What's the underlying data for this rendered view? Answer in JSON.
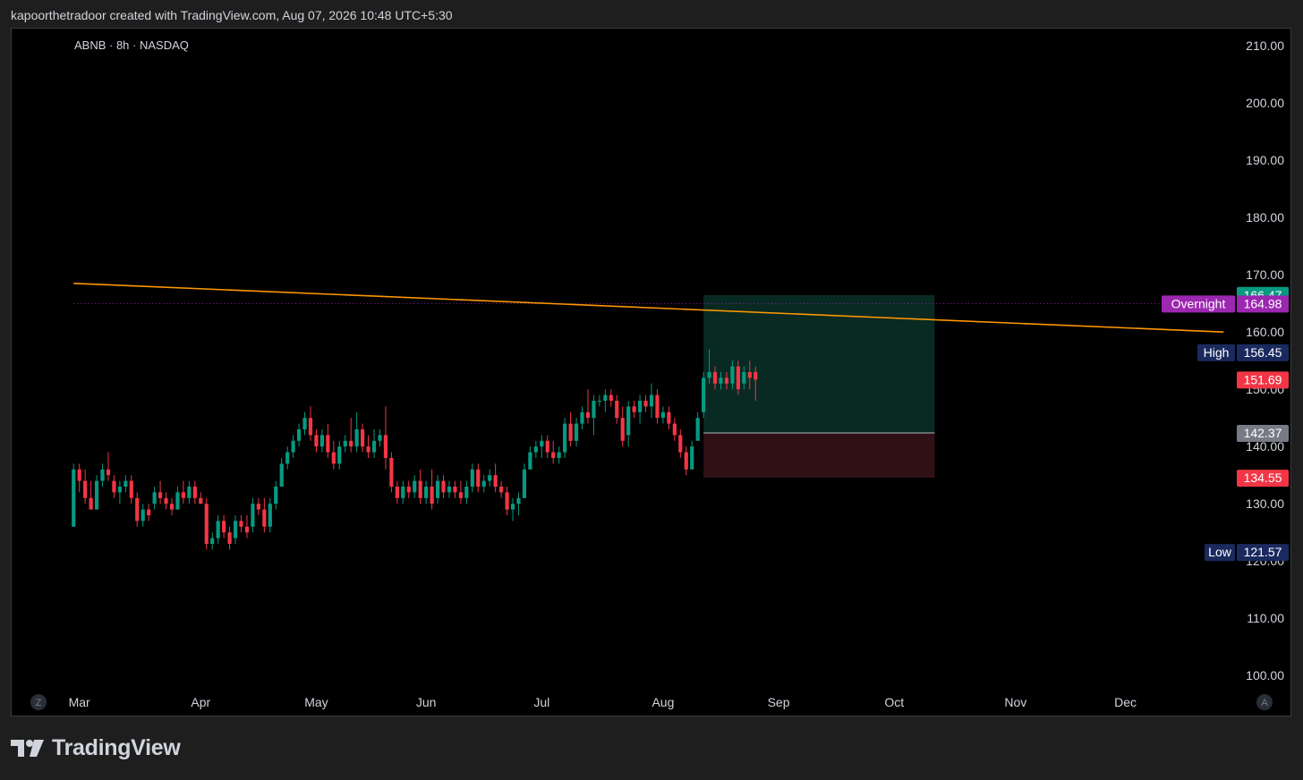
{
  "header": {
    "text": "kapoorthetradoor created with TradingView.com, Aug 07, 2026 10:48 UTC+5:30"
  },
  "footer": {
    "brand": "TradingView"
  },
  "chart_data": {
    "type": "candlestick",
    "title": "ABNB · 8h · NASDAQ",
    "symbol": "ABNB",
    "interval": "8h",
    "exchange": "NASDAQ",
    "ylim": [
      98,
      213
    ],
    "y_ticks": [
      "210.00",
      "200.00",
      "190.00",
      "180.00",
      "170.00",
      "160.00",
      "150.00",
      "140.00",
      "130.00",
      "120.00",
      "110.00",
      "100.00"
    ],
    "x_ticks": [
      {
        "label": "Mar",
        "index": 1
      },
      {
        "label": "Apr",
        "index": 22
      },
      {
        "label": "May",
        "index": 42
      },
      {
        "label": "Jun",
        "index": 61
      },
      {
        "label": "Jul",
        "index": 81
      },
      {
        "label": "Aug",
        "index": 102
      },
      {
        "label": "Sep",
        "index": 122
      },
      {
        "label": "Oct",
        "index": 142
      },
      {
        "label": "Nov",
        "index": 163
      },
      {
        "label": "Dec",
        "index": 182
      }
    ],
    "x_range": [
      -0.5,
      200.5
    ],
    "candles": [
      {
        "i": 0,
        "o": 126,
        "h": 137,
        "l": 126,
        "c": 136
      },
      {
        "i": 1,
        "o": 136,
        "h": 137,
        "l": 132,
        "c": 134
      },
      {
        "i": 2,
        "o": 134,
        "h": 136,
        "l": 130,
        "c": 131
      },
      {
        "i": 3,
        "o": 131,
        "h": 134,
        "l": 129,
        "c": 129
      },
      {
        "i": 4,
        "o": 129,
        "h": 135,
        "l": 129,
        "c": 134
      },
      {
        "i": 5,
        "o": 134,
        "h": 137,
        "l": 133,
        "c": 136
      },
      {
        "i": 6,
        "o": 136,
        "h": 139,
        "l": 134,
        "c": 135
      },
      {
        "i": 7,
        "o": 134,
        "h": 135,
        "l": 131,
        "c": 132
      },
      {
        "i": 8,
        "o": 132,
        "h": 134,
        "l": 130,
        "c": 133
      },
      {
        "i": 9,
        "o": 133,
        "h": 135,
        "l": 132,
        "c": 134
      },
      {
        "i": 10,
        "o": 134,
        "h": 135,
        "l": 130,
        "c": 131
      },
      {
        "i": 11,
        "o": 131,
        "h": 132,
        "l": 126,
        "c": 127
      },
      {
        "i": 12,
        "o": 127,
        "h": 130,
        "l": 126,
        "c": 129
      },
      {
        "i": 13,
        "o": 129,
        "h": 130,
        "l": 127,
        "c": 128
      },
      {
        "i": 14,
        "o": 130,
        "h": 133,
        "l": 129,
        "c": 132
      },
      {
        "i": 15,
        "o": 132,
        "h": 134,
        "l": 130,
        "c": 131
      },
      {
        "i": 16,
        "o": 131,
        "h": 132,
        "l": 129,
        "c": 130
      },
      {
        "i": 17,
        "o": 130,
        "h": 131,
        "l": 128,
        "c": 129
      },
      {
        "i": 18,
        "o": 129,
        "h": 133,
        "l": 129,
        "c": 132
      },
      {
        "i": 19,
        "o": 132,
        "h": 134,
        "l": 130,
        "c": 131
      },
      {
        "i": 20,
        "o": 131,
        "h": 134,
        "l": 130,
        "c": 133
      },
      {
        "i": 21,
        "o": 133,
        "h": 134,
        "l": 130,
        "c": 131
      },
      {
        "i": 22,
        "o": 131,
        "h": 132,
        "l": 130,
        "c": 130
      },
      {
        "i": 23,
        "o": 130,
        "h": 131,
        "l": 122,
        "c": 123
      },
      {
        "i": 24,
        "o": 123,
        "h": 125,
        "l": 122,
        "c": 124
      },
      {
        "i": 25,
        "o": 124,
        "h": 128,
        "l": 123,
        "c": 127
      },
      {
        "i": 26,
        "o": 127,
        "h": 128,
        "l": 124,
        "c": 125
      },
      {
        "i": 27,
        "o": 125,
        "h": 126,
        "l": 122,
        "c": 123
      },
      {
        "i": 28,
        "o": 124,
        "h": 128,
        "l": 123,
        "c": 127
      },
      {
        "i": 29,
        "o": 127,
        "h": 128,
        "l": 125,
        "c": 126
      },
      {
        "i": 30,
        "o": 126,
        "h": 128,
        "l": 124,
        "c": 125
      },
      {
        "i": 31,
        "o": 126,
        "h": 131,
        "l": 125,
        "c": 130
      },
      {
        "i": 32,
        "o": 130,
        "h": 131,
        "l": 128,
        "c": 129
      },
      {
        "i": 33,
        "o": 129,
        "h": 131,
        "l": 125,
        "c": 126
      },
      {
        "i": 34,
        "o": 126,
        "h": 131,
        "l": 125,
        "c": 130
      },
      {
        "i": 35,
        "o": 130,
        "h": 134,
        "l": 129,
        "c": 133
      },
      {
        "i": 36,
        "o": 133,
        "h": 138,
        "l": 133,
        "c": 137
      },
      {
        "i": 37,
        "o": 137,
        "h": 140,
        "l": 136,
        "c": 139
      },
      {
        "i": 38,
        "o": 139,
        "h": 142,
        "l": 138,
        "c": 141
      },
      {
        "i": 39,
        "o": 141,
        "h": 144,
        "l": 140,
        "c": 143
      },
      {
        "i": 40,
        "o": 143,
        "h": 146,
        "l": 142,
        "c": 145
      },
      {
        "i": 41,
        "o": 145,
        "h": 147,
        "l": 141,
        "c": 142
      },
      {
        "i": 42,
        "o": 142,
        "h": 143,
        "l": 139,
        "c": 140
      },
      {
        "i": 43,
        "o": 140,
        "h": 143,
        "l": 139,
        "c": 142
      },
      {
        "i": 44,
        "o": 142,
        "h": 144,
        "l": 138,
        "c": 139
      },
      {
        "i": 45,
        "o": 139,
        "h": 141,
        "l": 136,
        "c": 137
      },
      {
        "i": 46,
        "o": 137,
        "h": 141,
        "l": 136,
        "c": 140
      },
      {
        "i": 47,
        "o": 140,
        "h": 142,
        "l": 139,
        "c": 141
      },
      {
        "i": 48,
        "o": 141,
        "h": 145,
        "l": 139,
        "c": 140
      },
      {
        "i": 49,
        "o": 140,
        "h": 146,
        "l": 139,
        "c": 143
      },
      {
        "i": 50,
        "o": 143,
        "h": 144,
        "l": 139,
        "c": 140
      },
      {
        "i": 51,
        "o": 140,
        "h": 142,
        "l": 138,
        "c": 139
      },
      {
        "i": 52,
        "o": 139,
        "h": 143,
        "l": 138,
        "c": 141
      },
      {
        "i": 53,
        "o": 141,
        "h": 143,
        "l": 140,
        "c": 142
      },
      {
        "i": 54,
        "o": 142,
        "h": 147,
        "l": 136,
        "c": 138
      },
      {
        "i": 55,
        "o": 138,
        "h": 139,
        "l": 132,
        "c": 133
      },
      {
        "i": 56,
        "o": 133,
        "h": 134,
        "l": 130,
        "c": 131
      },
      {
        "i": 57,
        "o": 131,
        "h": 134,
        "l": 130,
        "c": 133
      },
      {
        "i": 58,
        "o": 133,
        "h": 134,
        "l": 131,
        "c": 132
      },
      {
        "i": 59,
        "o": 132,
        "h": 135,
        "l": 131,
        "c": 134
      },
      {
        "i": 60,
        "o": 134,
        "h": 136,
        "l": 130,
        "c": 131
      },
      {
        "i": 61,
        "o": 131,
        "h": 134,
        "l": 130,
        "c": 133
      },
      {
        "i": 62,
        "o": 133,
        "h": 136,
        "l": 129,
        "c": 130
      },
      {
        "i": 63,
        "o": 131,
        "h": 135,
        "l": 130,
        "c": 134
      },
      {
        "i": 64,
        "o": 134,
        "h": 135,
        "l": 131,
        "c": 132
      },
      {
        "i": 65,
        "o": 132,
        "h": 134,
        "l": 131,
        "c": 133
      },
      {
        "i": 66,
        "o": 133,
        "h": 134,
        "l": 131,
        "c": 132
      },
      {
        "i": 67,
        "o": 132,
        "h": 134,
        "l": 130,
        "c": 131
      },
      {
        "i": 68,
        "o": 131,
        "h": 134,
        "l": 130,
        "c": 133
      },
      {
        "i": 69,
        "o": 133,
        "h": 137,
        "l": 132,
        "c": 136
      },
      {
        "i": 70,
        "o": 136,
        "h": 137,
        "l": 132,
        "c": 133
      },
      {
        "i": 71,
        "o": 133,
        "h": 135,
        "l": 132,
        "c": 134
      },
      {
        "i": 72,
        "o": 134,
        "h": 136,
        "l": 133,
        "c": 135
      },
      {
        "i": 73,
        "o": 135,
        "h": 137,
        "l": 132,
        "c": 133
      },
      {
        "i": 74,
        "o": 133,
        "h": 134,
        "l": 131,
        "c": 132
      },
      {
        "i": 75,
        "o": 132,
        "h": 133,
        "l": 128,
        "c": 129
      },
      {
        "i": 76,
        "o": 129,
        "h": 131,
        "l": 127,
        "c": 130
      },
      {
        "i": 77,
        "o": 130,
        "h": 132,
        "l": 128,
        "c": 131
      },
      {
        "i": 78,
        "o": 131,
        "h": 137,
        "l": 131,
        "c": 136
      },
      {
        "i": 79,
        "o": 136,
        "h": 140,
        "l": 136,
        "c": 139
      },
      {
        "i": 80,
        "o": 139,
        "h": 141,
        "l": 138,
        "c": 140
      },
      {
        "i": 81,
        "o": 140,
        "h": 142,
        "l": 138,
        "c": 141
      },
      {
        "i": 82,
        "o": 141,
        "h": 142,
        "l": 138,
        "c": 139
      },
      {
        "i": 83,
        "o": 139,
        "h": 141,
        "l": 137,
        "c": 138
      },
      {
        "i": 84,
        "o": 138,
        "h": 140,
        "l": 137,
        "c": 139
      },
      {
        "i": 85,
        "o": 139,
        "h": 145,
        "l": 138,
        "c": 144
      },
      {
        "i": 86,
        "o": 144,
        "h": 146,
        "l": 140,
        "c": 141
      },
      {
        "i": 87,
        "o": 141,
        "h": 145,
        "l": 140,
        "c": 144
      },
      {
        "i": 88,
        "o": 144,
        "h": 147,
        "l": 143,
        "c": 146
      },
      {
        "i": 89,
        "o": 146,
        "h": 150,
        "l": 144,
        "c": 145
      },
      {
        "i": 90,
        "o": 145,
        "h": 149,
        "l": 142,
        "c": 148
      },
      {
        "i": 91,
        "o": 148,
        "h": 149,
        "l": 147,
        "c": 148
      },
      {
        "i": 92,
        "o": 148,
        "h": 150,
        "l": 146,
        "c": 149
      },
      {
        "i": 93,
        "o": 149,
        "h": 150,
        "l": 147,
        "c": 148
      },
      {
        "i": 94,
        "o": 148,
        "h": 149,
        "l": 144,
        "c": 145
      },
      {
        "i": 95,
        "o": 145,
        "h": 147,
        "l": 140,
        "c": 141
      },
      {
        "i": 96,
        "o": 142,
        "h": 148,
        "l": 140,
        "c": 147
      },
      {
        "i": 97,
        "o": 147,
        "h": 148,
        "l": 145,
        "c": 146
      },
      {
        "i": 98,
        "o": 146,
        "h": 149,
        "l": 144,
        "c": 148
      },
      {
        "i": 99,
        "o": 148,
        "h": 149,
        "l": 146,
        "c": 147
      },
      {
        "i": 100,
        "o": 147,
        "h": 151,
        "l": 145,
        "c": 149
      },
      {
        "i": 101,
        "o": 149,
        "h": 150,
        "l": 144,
        "c": 145
      },
      {
        "i": 102,
        "o": 145,
        "h": 147,
        "l": 144,
        "c": 146
      },
      {
        "i": 103,
        "o": 146,
        "h": 147,
        "l": 143,
        "c": 144
      },
      {
        "i": 104,
        "o": 144,
        "h": 145,
        "l": 141,
        "c": 142
      },
      {
        "i": 105,
        "o": 142,
        "h": 143,
        "l": 138,
        "c": 139
      },
      {
        "i": 106,
        "o": 139,
        "h": 140,
        "l": 135,
        "c": 136
      },
      {
        "i": 107,
        "o": 136,
        "h": 141,
        "l": 136,
        "c": 140
      },
      {
        "i": 108,
        "o": 141,
        "h": 146,
        "l": 141,
        "c": 145
      },
      {
        "i": 109,
        "o": 146,
        "h": 153,
        "l": 145,
        "c": 152
      },
      {
        "i": 110,
        "o": 152,
        "h": 157,
        "l": 151,
        "c": 153
      },
      {
        "i": 111,
        "o": 153,
        "h": 154,
        "l": 150,
        "c": 151
      },
      {
        "i": 112,
        "o": 151,
        "h": 153,
        "l": 150,
        "c": 152
      },
      {
        "i": 113,
        "o": 152,
        "h": 153,
        "l": 150,
        "c": 151
      },
      {
        "i": 114,
        "o": 151,
        "h": 155,
        "l": 150,
        "c": 154
      },
      {
        "i": 115,
        "o": 154,
        "h": 155,
        "l": 149,
        "c": 150
      },
      {
        "i": 116,
        "o": 151,
        "h": 154,
        "l": 150,
        "c": 153
      },
      {
        "i": 117,
        "o": 153,
        "h": 155,
        "l": 150,
        "c": 152
      },
      {
        "i": 118,
        "o": 153,
        "h": 154,
        "l": 148,
        "c": 151.69
      }
    ],
    "trendline": {
      "from": {
        "i": 0,
        "y": 168.5
      },
      "to": {
        "i": 199,
        "y": 160.0
      },
      "color": "#ff9800"
    },
    "position": {
      "from_i": 109,
      "to_i": 149,
      "entry": 142.37,
      "target": 166.47,
      "stop": 134.55,
      "profit_color": "#082a22",
      "loss_color": "#2f1115"
    },
    "overnight_line": {
      "y": 164.98,
      "color": "#9c27b0"
    },
    "price_labels": [
      {
        "name": "target",
        "value": "166.47",
        "y": 166.47,
        "bg": "#089981",
        "prefix": ""
      },
      {
        "name": "overnight",
        "value": "164.98",
        "y": 164.98,
        "bg": "#9c27b0",
        "prefix": "Overnight"
      },
      {
        "name": "high",
        "value": "156.45",
        "y": 156.45,
        "bg": "#1a2a5e",
        "prefix": "High"
      },
      {
        "name": "last-price",
        "value": "151.69",
        "y": 151.69,
        "bg": "#f23645",
        "prefix": ""
      },
      {
        "name": "entry",
        "value": "142.37",
        "y": 142.37,
        "bg": "#787b86",
        "prefix": ""
      },
      {
        "name": "stop",
        "value": "134.55",
        "y": 134.55,
        "bg": "#f23645",
        "prefix": ""
      },
      {
        "name": "low",
        "value": "121.57",
        "y": 121.57,
        "bg": "#1a2a5e",
        "prefix": "Low"
      }
    ],
    "colors": {
      "up": "#089981",
      "down": "#f23645",
      "text": "#d1d4dc",
      "background": "#000000"
    },
    "corner_buttons": {
      "left": "Z",
      "right": "A"
    }
  }
}
